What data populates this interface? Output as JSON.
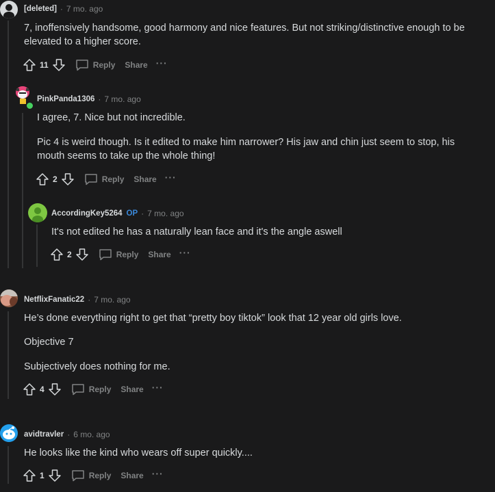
{
  "comments": [
    {
      "author": "[deleted]",
      "time": "7 mo. ago",
      "paragraphs": [
        "7, inoffensively handsome, good harmony and nice features. But not striking/distinctive enough to be elevated to a higher score."
      ],
      "votes": "11"
    },
    {
      "author": "PinkPanda1306",
      "time": "7 mo. ago",
      "paragraphs": [
        "I agree, 7. Nice but not incredible.",
        "Pic 4 is weird though. Is it edited to make him narrower? His jaw and chin just seem to stop, his mouth seems to take up the whole thing!"
      ],
      "votes": "2"
    },
    {
      "author": "AccordingKey5264",
      "badge": "OP",
      "time": "7 mo. ago",
      "paragraphs": [
        "It's not edited he has a naturally lean face and it's the angle aswell"
      ],
      "votes": "2"
    },
    {
      "author": "NetflixFanatic22",
      "time": "7 mo. ago",
      "paragraphs": [
        "He’s done everything right to get that “pretty boy tiktok” look that 12 year old girls love.",
        "Objective 7",
        "Subjectively does nothing for me."
      ],
      "votes": "4"
    },
    {
      "author": "avidtravler",
      "time": "6 mo. ago",
      "paragraphs": [
        "He looks like the kind who wears off super quickly...."
      ],
      "votes": "1"
    }
  ],
  "actions": {
    "reply": "Reply",
    "share": "Share",
    "more": "···"
  },
  "separator": "·",
  "colors": {
    "background": "#1a1a1b",
    "text": "#d7dadc",
    "muted": "#818384",
    "op_badge": "#3a88d9",
    "thread_line": "#343536"
  }
}
